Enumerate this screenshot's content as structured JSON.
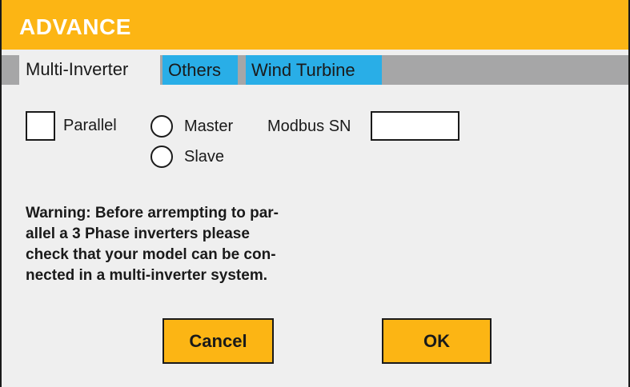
{
  "dialog": {
    "title": "ADVANCE"
  },
  "tabs": [
    {
      "label": "Multi-Inverter",
      "active": true
    },
    {
      "label": "Others",
      "active": false
    },
    {
      "label": "Wind Turbine",
      "active": false
    }
  ],
  "form": {
    "parallel_label": "Parallel",
    "parallel_checked": false,
    "master_label": "Master",
    "slave_label": "Slave",
    "modbus_label": "Modbus SN",
    "modbus_value": ""
  },
  "warning": {
    "lines": [
      "Warning: Before arrempting to par-",
      "allel a 3 Phase inverters please",
      "check that your model can be con-",
      "nected in a multi-inverter system."
    ]
  },
  "buttons": {
    "cancel": "Cancel",
    "ok": "OK"
  },
  "colors": {
    "accent": "#fcb514",
    "tab_blue": "#29aee7",
    "tab_strip": "#a6a6a7",
    "panel": "#efefef"
  }
}
